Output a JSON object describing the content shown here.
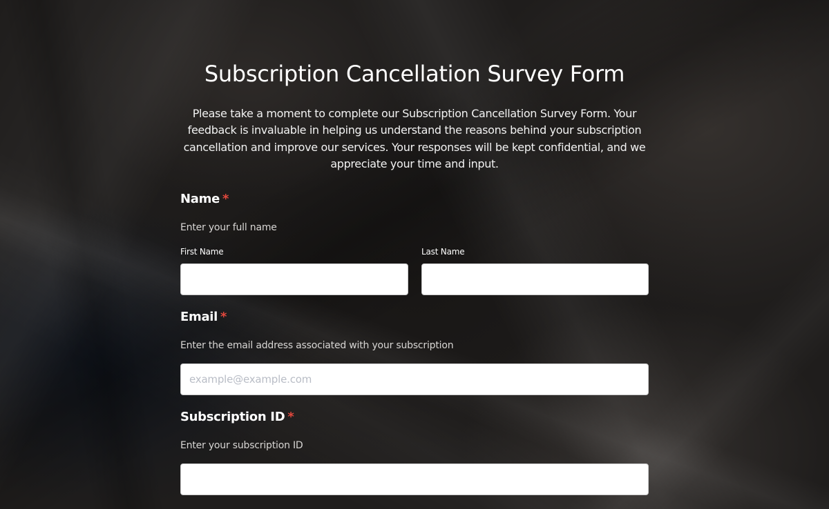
{
  "form": {
    "title": "Subscription Cancellation Survey Form",
    "description": "Please take a moment to complete our Subscription Cancellation Survey Form. Your feedback is invaluable in helping us understand the reasons behind your subscription cancellation and improve our services. Your responses will be kept confidential, and we appreciate your time and input.",
    "required_marker": "*",
    "colors": {
      "required": "#e2483d",
      "input_background": "#ffffff",
      "text": "#ffffff"
    }
  },
  "fields": {
    "name": {
      "label": "Name",
      "help": "Enter your full name",
      "first_label": "First Name",
      "first_value": "",
      "first_placeholder": "",
      "last_label": "Last Name",
      "last_value": "",
      "last_placeholder": ""
    },
    "email": {
      "label": "Email",
      "help": "Enter the email address associated with your subscription",
      "value": "",
      "placeholder": "example@example.com"
    },
    "subscription_id": {
      "label": "Subscription ID",
      "help": "Enter your subscription ID",
      "value": "",
      "placeholder": ""
    }
  }
}
